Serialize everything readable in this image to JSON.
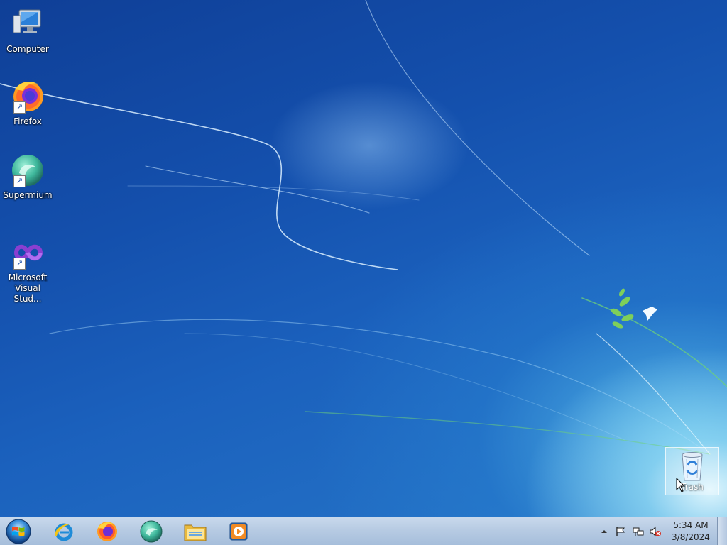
{
  "desktop": {
    "icons": [
      {
        "label": "Computer",
        "icon": "computer-icon"
      },
      {
        "label": "Firefox",
        "icon": "firefox-icon"
      },
      {
        "label": "Supermium",
        "icon": "supermium-icon"
      },
      {
        "label": "Microsoft Visual Stud...",
        "icon": "visual-studio-icon"
      }
    ],
    "trash": {
      "label": "Trash",
      "icon": "recycle-bin-icon"
    }
  },
  "taskbar": {
    "start": {
      "icon": "windows-start-icon"
    },
    "pinned": [
      {
        "name": "Internet Explorer",
        "icon": "internet-explorer-icon"
      },
      {
        "name": "Firefox",
        "icon": "firefox-icon"
      },
      {
        "name": "Supermium",
        "icon": "supermium-icon"
      },
      {
        "name": "File Explorer",
        "icon": "file-explorer-icon"
      },
      {
        "name": "Media Player",
        "icon": "media-player-icon"
      }
    ],
    "tray": {
      "icons": [
        "show-hidden-icons-icon",
        "action-center-flag-icon",
        "network-icon",
        "volume-muted-icon"
      ],
      "time": "5:34 AM",
      "date": "3/8/2024"
    }
  },
  "colors": {
    "desktop_blue": "#1450ad",
    "taskbar": "#b7cbe3"
  }
}
